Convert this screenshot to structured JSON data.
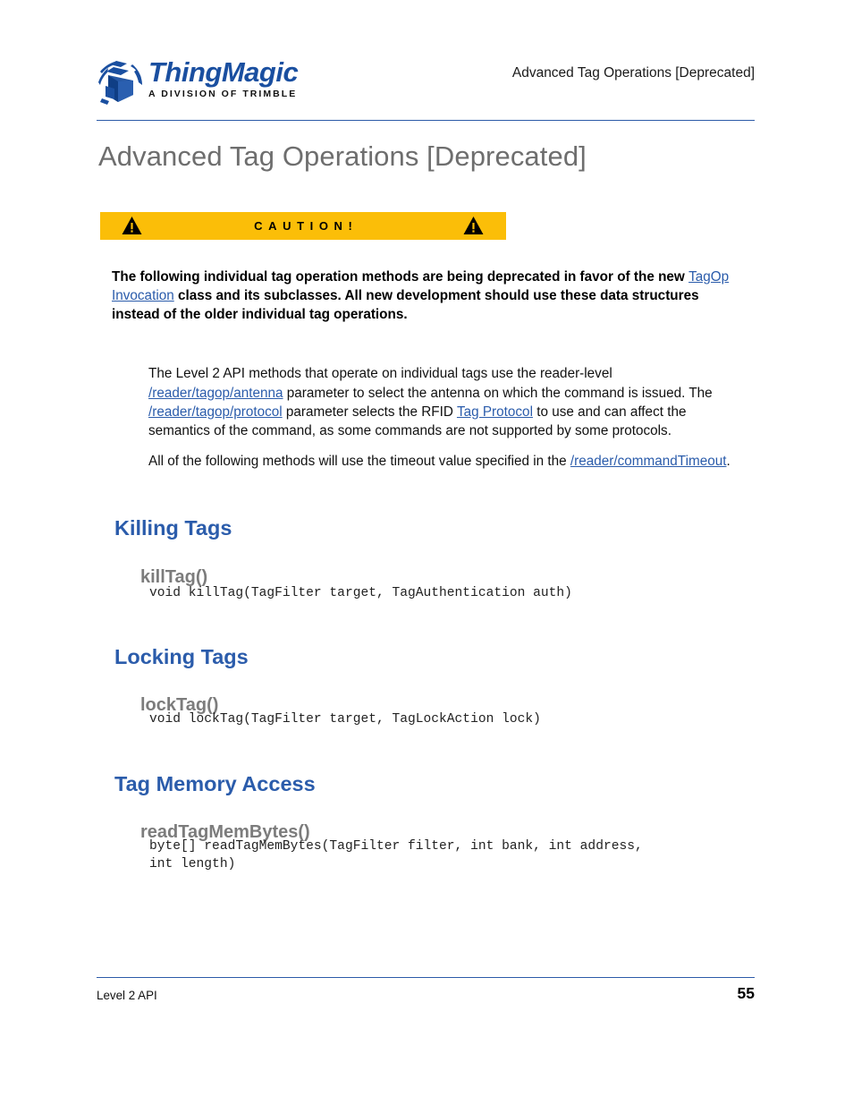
{
  "header": {
    "logo_word": "ThingMagic",
    "logo_sub": "A DIVISION OF TRIMBLE",
    "logo_mark_icon": "stacked-cube-icon",
    "running_head": "Advanced Tag Operations [Deprecated]"
  },
  "page_title": "Advanced Tag Operations [Deprecated]",
  "caution": {
    "label": "CAUTION!",
    "bg_color": "#FBBE08",
    "icon_left": "warning-triangle-icon",
    "icon_right": "warning-triangle-icon",
    "body_prefix": "The following individual tag operation methods are being deprecated in favor of the new ",
    "body_link": "TagOp Invocation",
    "body_suffix": " class and its subclasses. All new development should use these data structures instead of the older individual tag operations."
  },
  "paragraphs": [
    {
      "parts": [
        {
          "type": "text",
          "value": "The Level 2 API methods that operate on individual tags use the reader-level "
        },
        {
          "type": "link",
          "value": "/reader/tagop/antenna"
        },
        {
          "type": "text",
          "value": " parameter to select the antenna on which the command is issued. The "
        },
        {
          "type": "link",
          "value": "/reader/tagop/protocol"
        },
        {
          "type": "text",
          "value": " parameter selects the RFID "
        },
        {
          "type": "link",
          "value": "Tag Protocol"
        },
        {
          "type": "text",
          "value": " to use and can affect the semantics of the command, as some commands are not supported by some protocols."
        }
      ]
    },
    {
      "parts": [
        {
          "type": "text",
          "value": "All of the following methods will use the timeout value specified in the "
        },
        {
          "type": "link",
          "value": "/reader/commandTimeout"
        },
        {
          "type": "text",
          "value": "."
        }
      ]
    }
  ],
  "sections": [
    {
      "heading": "Killing Tags",
      "method": "killTag()",
      "signature": "void killTag(TagFilter target, TagAuthentication auth)"
    },
    {
      "heading": "Locking Tags",
      "method": "lockTag()",
      "signature": "void lockTag(TagFilter target, TagLockAction lock)"
    },
    {
      "heading": "Tag Memory Access",
      "method": "readTagMemBytes()",
      "signature": "byte[] readTagMemBytes(TagFilter filter, int bank, int address,\nint length)"
    }
  ],
  "footer": {
    "left": "Level 2 API",
    "page_number": "55"
  },
  "colors": {
    "heading_blue": "#2B5CAB",
    "rule_blue": "#2C5BA8",
    "title_gray": "#6E6E6E",
    "subheading_gray": "#7C7C7C",
    "caution_yellow": "#FBBE08",
    "logo_blue": "#1A4FA0"
  }
}
